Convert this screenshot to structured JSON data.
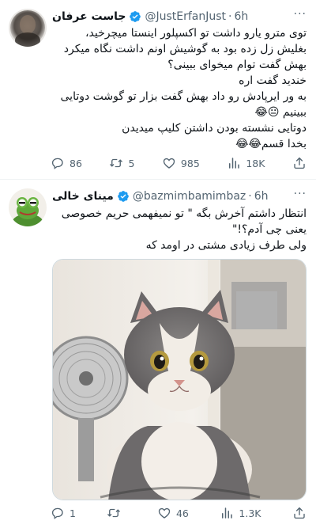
{
  "tweet1": {
    "name": "جاست عرفان",
    "handle": "@JustErfanJust",
    "time": "6h",
    "lines": [
      "توی مترو یارو داشت تو اکسپلور اینستا میچرخید،",
      "بغلیش زل زده بود به گوشیش اونم داشت نگاه میکرد",
      "بهش گفت توام میخوای ببینی؟",
      "خندید گفت اره",
      "به ور ایرپادش رو داد بهش گفت بزار تو گوشت دوتایی",
      "ببینیم 😐😂",
      "دوتایی نشسته بودن داشتن کلیپ میدیدن",
      "بخدا قسم😂😂"
    ],
    "stats": {
      "replies": "86",
      "reposts": "5",
      "likes": "985",
      "views": "18K"
    }
  },
  "tweet2": {
    "name": "مینای خالی",
    "handle": "@bazmimbamimbaz",
    "time": "6h",
    "lines": [
      "انتظار داشتم آخرش بگه \" تو نمیفهمی حریم خصوصی",
      "یعنی چی آدم؟!\"",
      "ولی طرف زیادی مشتی در اومد که"
    ],
    "image_alt": "cat photo",
    "stats": {
      "replies": "1",
      "reposts": "",
      "likes": "46",
      "views": "1.3K"
    }
  },
  "icons": {
    "more": "more-icon",
    "verified": "verified-badge-icon",
    "reply": "reply-icon",
    "repost": "repost-icon",
    "like": "like-icon",
    "views": "views-icon",
    "share": "share-icon"
  },
  "colors": {
    "verified": "#1d9bf0",
    "muted": "#536471",
    "text": "#0f1419"
  }
}
